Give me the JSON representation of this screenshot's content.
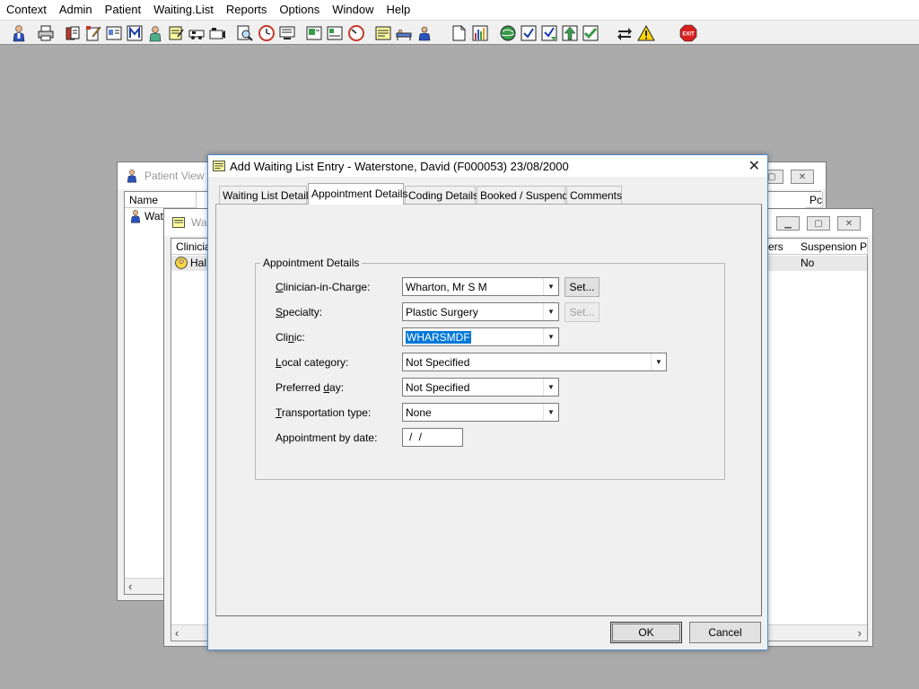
{
  "menu": [
    "Context",
    "Admin",
    "Patient",
    "Waiting.List",
    "Reports",
    "Options",
    "Window",
    "Help"
  ],
  "toolbar_icons": [
    "patient-icon",
    "printer-icon",
    "folders-icon",
    "edit-icon",
    "id-card-icon",
    "m-icon",
    "doctor-icon",
    "notes-icon",
    "ambulance-icon",
    "camera-icon",
    "find-icon",
    "clock-icon",
    "monitor-icon",
    "photo-icon",
    "forms-icon",
    "dial-icon",
    "note-icon",
    "bed-icon",
    "user-card-icon",
    "document-icon",
    "bar-chart-icon",
    "globe-icon",
    "check-icon",
    "check-down-icon",
    "green-arrow-icon",
    "green-check-icon",
    "transfer-icon",
    "warning-icon",
    "exit-icon"
  ],
  "exit_label": "EXIT",
  "bg_window_1": {
    "title": "Patient View",
    "col1": "Name",
    "col2": "Pc",
    "row1": "Wate"
  },
  "bg_window_2": {
    "title": "Wa",
    "col1": "Clinicia",
    "col2": "ers",
    "col3": "Suspension Pe",
    "row1": "Hal",
    "row1_suspension": "No"
  },
  "dialog": {
    "title": "Add Waiting List Entry - Waterstone, David (F000053) 23/08/2000",
    "close": "✕",
    "tabs": [
      "Waiting List Details",
      "Appointment Details",
      "Coding Details",
      "Booked / Suspend",
      "Comments"
    ],
    "active_tab": "Appointment Details",
    "group_title": "Appointment Details",
    "fields": {
      "clinician": {
        "label": "Clinician-in-Charge:",
        "value": "Wharton, Mr S M",
        "button": "Set..."
      },
      "specialty": {
        "label": "Specialty:",
        "value": "Plastic Surgery",
        "button": "Set..."
      },
      "clinic": {
        "label": "Clinic:",
        "value": "WHARSMDF"
      },
      "local_category": {
        "label": "Local category:",
        "value": "Not Specified"
      },
      "preferred_day": {
        "label": "Preferred day:",
        "value": "Not Specified"
      },
      "transport": {
        "label": "Transportation type:",
        "value": "None"
      },
      "appt_by_date": {
        "label": "Appointment by date:",
        "value": " /  /"
      }
    },
    "ok": "OK",
    "cancel": "Cancel"
  },
  "colors": {
    "workspace": "#ababab",
    "selection": "#0078d7",
    "dialog_border": "#4a8cd8"
  }
}
